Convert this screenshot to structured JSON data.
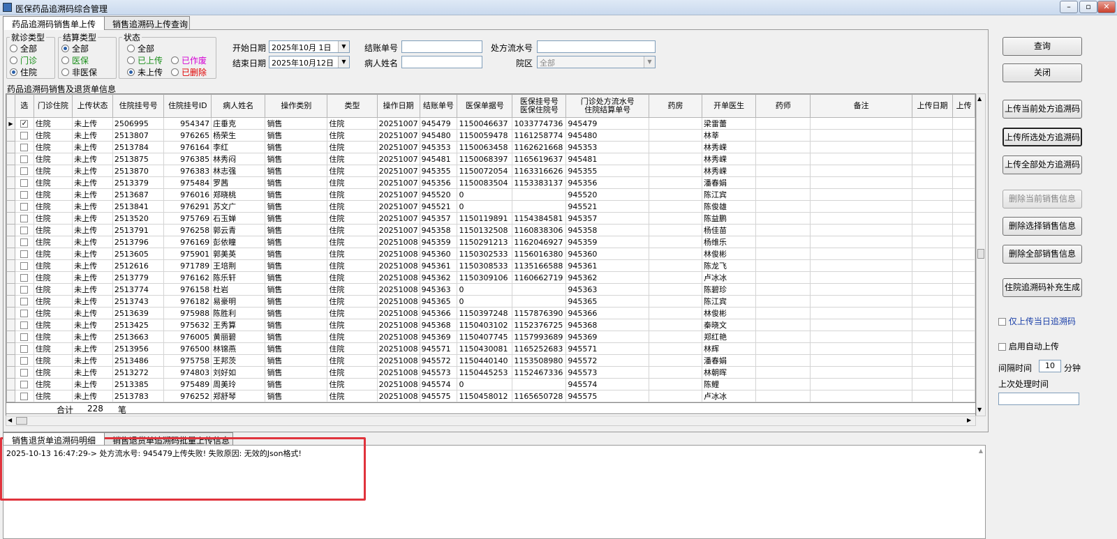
{
  "window": {
    "title": "医保药品追溯码综合管理",
    "min": "–",
    "max": "▫",
    "close": "✕"
  },
  "tabs_top": [
    "药品追溯码销售单上传",
    "销售追溯码上传查询"
  ],
  "filters": {
    "visit_type": {
      "legend": "就诊类型",
      "options": [
        "全部",
        "门诊",
        "住院"
      ],
      "selected": "住院"
    },
    "settle_type": {
      "legend": "结算类型",
      "options": [
        "全部",
        "医保",
        "非医保"
      ],
      "selected": "全部"
    },
    "status": {
      "legend": "状态",
      "options": [
        "全部",
        "已上传",
        "已作废",
        "未上传",
        "已删除"
      ],
      "selected": "未上传"
    },
    "start_date_label": "开始日期",
    "start_date": "2025年10月 1日",
    "end_date_label": "结束日期",
    "end_date": "2025年10月12日",
    "bill_no_label": "结账单号",
    "bill_no": "",
    "patient_label": "病人姓名",
    "patient": "",
    "rx_flow_label": "处方流水号",
    "rx_flow": "",
    "campus_label": "院区",
    "campus": "全部"
  },
  "grid": {
    "title": "药品追溯码销售及退货单信息",
    "columns": [
      "选",
      "门诊住院",
      "上传状态",
      "住院挂号号",
      "住院挂号ID",
      "病人姓名",
      "操作类别",
      "类型",
      "操作日期",
      "结账单号",
      "医保单据号",
      "医保挂号号\n医保住院号",
      "门诊处方流水号\n住院结算单号",
      "药房",
      "开单医生",
      "药师",
      "备注",
      "上传日期",
      "上传"
    ],
    "rows": [
      [
        "✓",
        "住院",
        "未上传",
        "2506995",
        "954347",
        "庄垂克",
        "销售",
        "住院",
        "20251007",
        "945479",
        "1150046637",
        "1033774736",
        "945479",
        "",
        "梁雷蕾"
      ],
      [
        "",
        "住院",
        "未上传",
        "2513807",
        "976265",
        "杨荣生",
        "销售",
        "住院",
        "20251007",
        "945480",
        "1150059478",
        "1161258774",
        "945480",
        "",
        "林莘"
      ],
      [
        "",
        "住院",
        "未上传",
        "2513784",
        "976164",
        "李红",
        "销售",
        "住院",
        "20251007",
        "945353",
        "1150063458",
        "1162621668",
        "945353",
        "",
        "林秀嵘"
      ],
      [
        "",
        "住院",
        "未上传",
        "2513875",
        "976385",
        "林秀闷",
        "销售",
        "住院",
        "20251007",
        "945481",
        "1150068397",
        "1165619637",
        "945481",
        "",
        "林秀嵘"
      ],
      [
        "",
        "住院",
        "未上传",
        "2513870",
        "976383",
        "林志强",
        "销售",
        "住院",
        "20251007",
        "945355",
        "1150072054",
        "1163316626",
        "945355",
        "",
        "林秀嵘"
      ],
      [
        "",
        "住院",
        "未上传",
        "2513379",
        "975484",
        "罗茜",
        "销售",
        "住院",
        "20251007",
        "945356",
        "1150083504",
        "1153383137",
        "945356",
        "",
        "潘春娟"
      ],
      [
        "",
        "住院",
        "未上传",
        "2513687",
        "976016",
        "郑晓桃",
        "销售",
        "住院",
        "20251007",
        "945520",
        "0",
        "",
        "945520",
        "",
        "陈江宾"
      ],
      [
        "",
        "住院",
        "未上传",
        "2513841",
        "976291",
        "苏文广",
        "销售",
        "住院",
        "20251007",
        "945521",
        "0",
        "",
        "945521",
        "",
        "陈俊雄"
      ],
      [
        "",
        "住院",
        "未上传",
        "2513520",
        "975769",
        "石玉婵",
        "销售",
        "住院",
        "20251007",
        "945357",
        "1150119891",
        "1154384581",
        "945357",
        "",
        "陈益鹏"
      ],
      [
        "",
        "住院",
        "未上传",
        "2513791",
        "976258",
        "郭云青",
        "销售",
        "住院",
        "20251007",
        "945358",
        "1150132508",
        "1160838306",
        "945358",
        "",
        "杨佳苗"
      ],
      [
        "",
        "住院",
        "未上传",
        "2513796",
        "976169",
        "彭依瞳",
        "销售",
        "住院",
        "20251008",
        "945359",
        "1150291213",
        "1162046927",
        "945359",
        "",
        "杨维乐"
      ],
      [
        "",
        "住院",
        "未上传",
        "2513605",
        "975901",
        "郭美英",
        "销售",
        "住院",
        "20251008",
        "945360",
        "1150302533",
        "1156016380",
        "945360",
        "",
        "林俊彬"
      ],
      [
        "",
        "住院",
        "未上传",
        "2512616",
        "971789",
        "王培荆",
        "销售",
        "住院",
        "20251008",
        "945361",
        "1150308533",
        "1135166588",
        "945361",
        "",
        "陈龙飞"
      ],
      [
        "",
        "住院",
        "未上传",
        "2513779",
        "976162",
        "陈乐轩",
        "销售",
        "住院",
        "20251008",
        "945362",
        "1150309106",
        "1160662719",
        "945362",
        "",
        "卢冰冰"
      ],
      [
        "",
        "住院",
        "未上传",
        "2513774",
        "976158",
        "杜岩",
        "销售",
        "住院",
        "20251008",
        "945363",
        "0",
        "",
        "945363",
        "",
        "陈碧珍"
      ],
      [
        "",
        "住院",
        "未上传",
        "2513743",
        "976182",
        "易豪明",
        "销售",
        "住院",
        "20251008",
        "945365",
        "0",
        "",
        "945365",
        "",
        "陈江宾"
      ],
      [
        "",
        "住院",
        "未上传",
        "2513639",
        "975988",
        "陈胜利",
        "销售",
        "住院",
        "20251008",
        "945366",
        "1150397248",
        "1157876390",
        "945366",
        "",
        "林俊彬"
      ],
      [
        "",
        "住院",
        "未上传",
        "2513425",
        "975632",
        "王秀算",
        "销售",
        "住院",
        "20251008",
        "945368",
        "1150403102",
        "1152376725",
        "945368",
        "",
        "秦晓文"
      ],
      [
        "",
        "住院",
        "未上传",
        "2513663",
        "976005",
        "黄丽碧",
        "销售",
        "住院",
        "20251008",
        "945369",
        "1150407745",
        "1157993689",
        "945369",
        "",
        "郑红艳"
      ],
      [
        "",
        "住院",
        "未上传",
        "2513956",
        "976500",
        "林锦燕",
        "销售",
        "住院",
        "20251008",
        "945571",
        "1150430081",
        "1165252683",
        "945571",
        "",
        "林辉"
      ],
      [
        "",
        "住院",
        "未上传",
        "2513486",
        "975758",
        "王邦茨",
        "销售",
        "住院",
        "20251008",
        "945572",
        "1150440140",
        "1153508980",
        "945572",
        "",
        "潘春娟"
      ],
      [
        "",
        "住院",
        "未上传",
        "2513272",
        "974803",
        "刘好如",
        "销售",
        "住院",
        "20251008",
        "945573",
        "1150445253",
        "1152467336",
        "945573",
        "",
        "林朝晖"
      ],
      [
        "",
        "住院",
        "未上传",
        "2513385",
        "975489",
        "周美玲",
        "销售",
        "住院",
        "20251008",
        "945574",
        "0",
        "",
        "945574",
        "",
        "陈鲤"
      ],
      [
        "",
        "住院",
        "未上传",
        "2513783",
        "976252",
        "郑舒琴",
        "销售",
        "住院",
        "20251008",
        "945575",
        "1150458012",
        "1165650728",
        "945575",
        "",
        "卢冰冰"
      ]
    ],
    "summary": {
      "label": "合计",
      "count": "228",
      "unit": "笔"
    }
  },
  "tabs_bottom": [
    "销售退货单追溯码明细",
    "销售退货单追溯码批量上传信息"
  ],
  "log": {
    "line": "2025-10-13 16:47:29-> 处方流水号: 945479上传失败! 失败原因: 无效的Json格式!"
  },
  "right_panel": {
    "query": "查询",
    "close": "关闭",
    "upload_current": "上传当前处方追溯码",
    "upload_selected": "上传所选处方追溯码",
    "upload_all": "上传全部处方追溯码",
    "delete_current": "删除当前销售信息",
    "delete_selected": "删除选择销售信息",
    "delete_all": "删除全部销售信息",
    "generate": "住院追溯码补充生成",
    "only_today": "仅上传当日追溯码",
    "auto_upload": "启用自动上传",
    "interval_label": "间隔时间",
    "interval_value": "10",
    "interval_unit": "分钟",
    "last_time_label": "上次处理时间",
    "last_time_value": ""
  },
  "colors": {
    "highlight": "#e0333c",
    "uploaded": "#1a8f1a",
    "voided": "#d400d4",
    "deleted": "#e00000"
  }
}
